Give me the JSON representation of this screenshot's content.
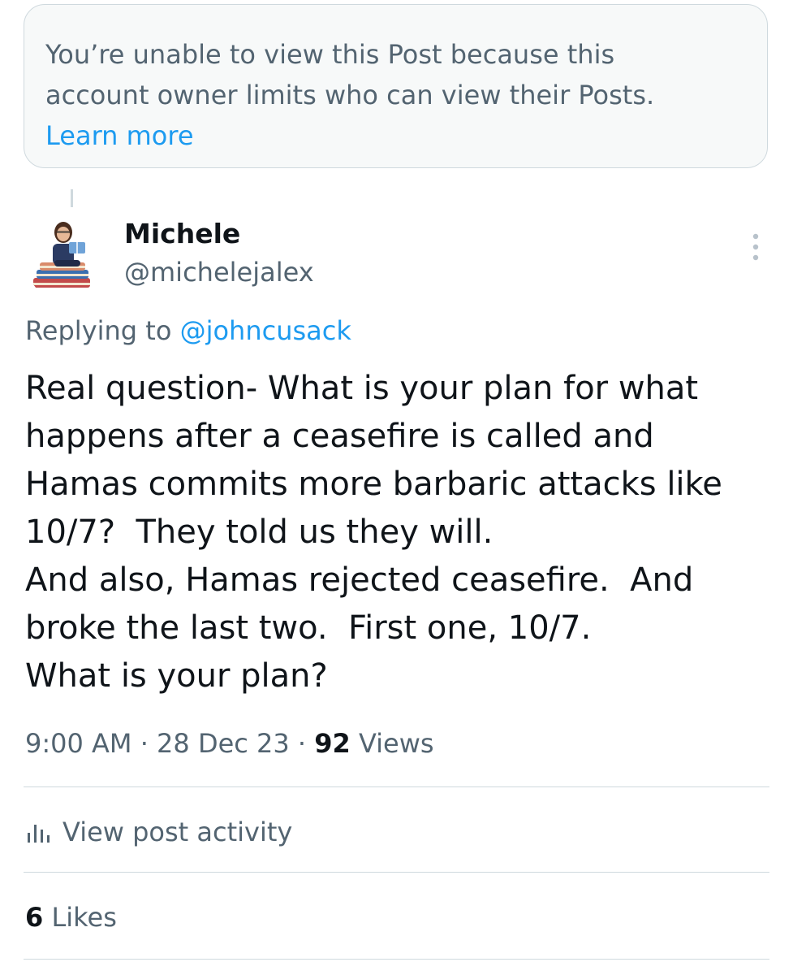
{
  "notice": {
    "line1": "You’re unable to view this Post because this",
    "line2": "account owner limits who can view their Posts.",
    "link": "Learn more"
  },
  "post": {
    "author_name": "Michele",
    "author_handle": "@michelejalex",
    "replying_prefix": "Replying to ",
    "replying_to": "@johncusack",
    "body_lines": [
      "Real question- What is your plan for what",
      "happens after a ceasefire is called and",
      "Hamas commits more barbaric attacks like",
      "10/7?  They told us they will.",
      "And also, Hamas rejected ceasefire.  And",
      "broke the last two.  First one, 10/7.",
      "What is your plan?"
    ],
    "time": "9:00 AM",
    "separator": " · ",
    "date": "28 Dec 23",
    "views_count": "92",
    "views_label": " Views",
    "activity_label": "View post activity",
    "likes_count": "6",
    "likes_label": " Likes"
  },
  "icons": {
    "more": "more-vertical-icon",
    "activity": "bar-chart-icon",
    "avatar": "bitmoji-avatar"
  },
  "colors": {
    "link": "#1d9bf0",
    "secondary_text": "#536471",
    "primary_text": "#0f1419",
    "notice_bg": "#f7f9f9",
    "border": "#cfd9de"
  }
}
